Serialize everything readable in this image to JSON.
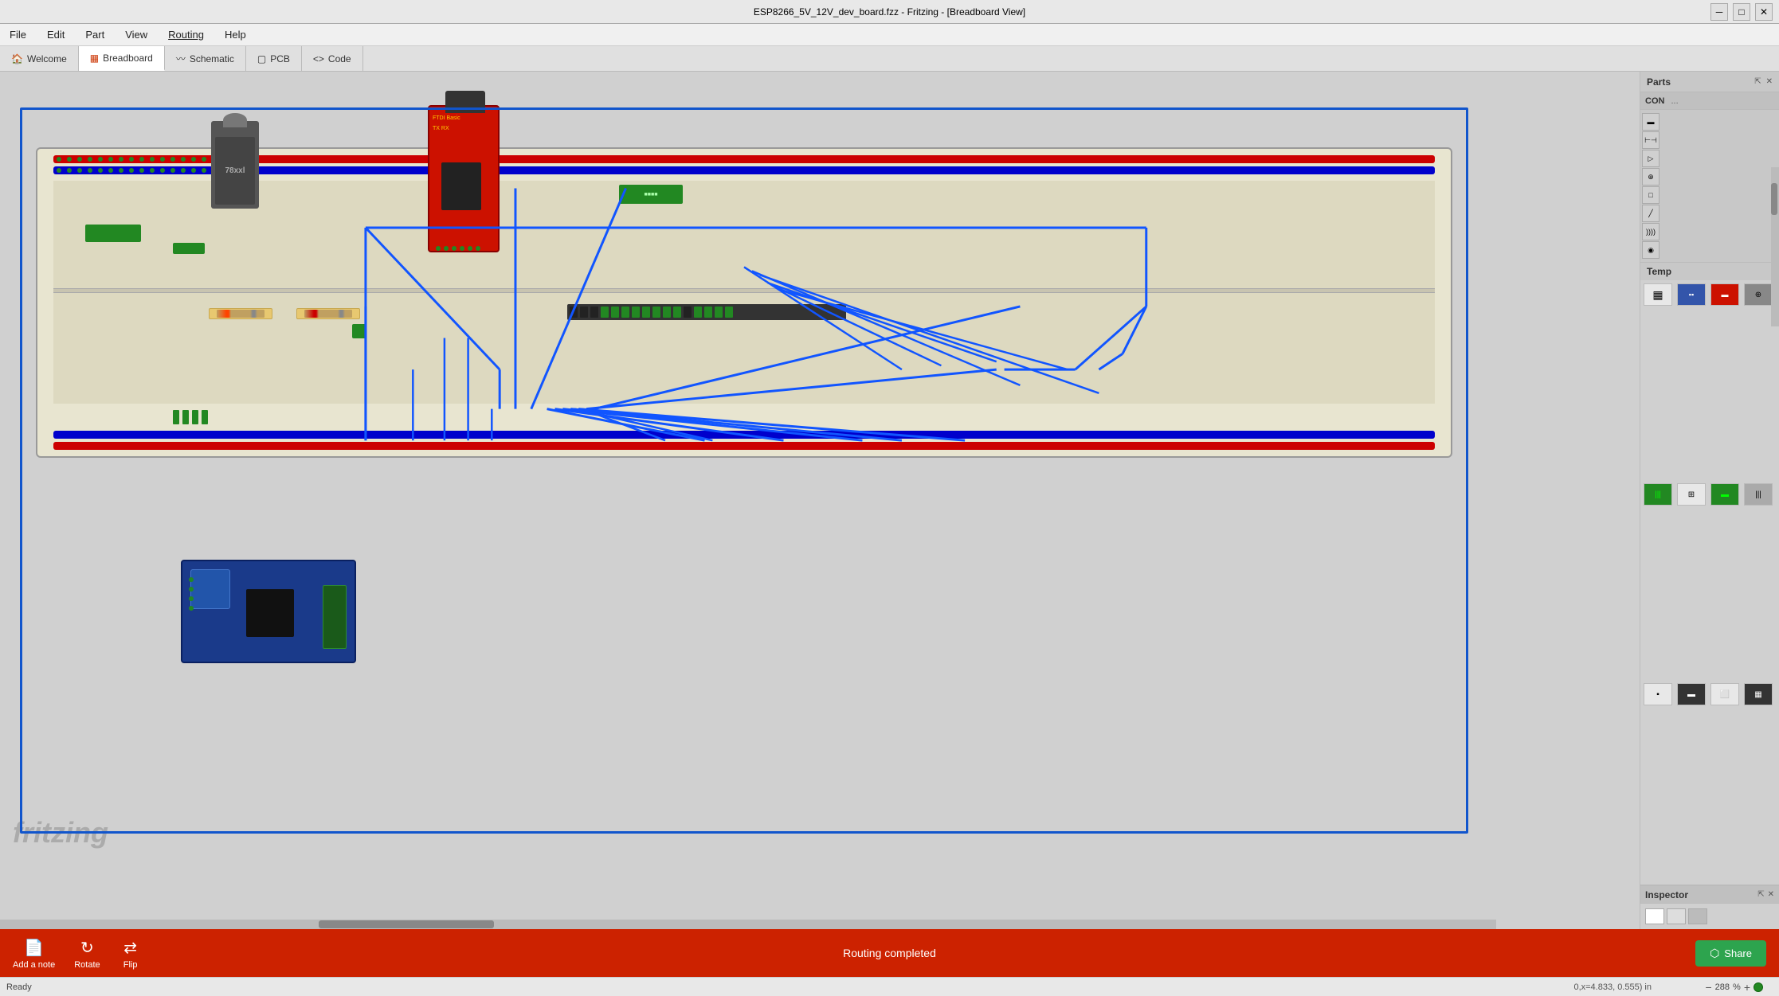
{
  "window": {
    "title": "ESP8266_5V_12V_dev_board.fzz - Fritzing - [Breadboard View]",
    "min_btn": "─",
    "max_btn": "□",
    "close_btn": "✕"
  },
  "menu": {
    "items": [
      "File",
      "Edit",
      "Part",
      "View",
      "Routing",
      "Help"
    ]
  },
  "tabs": [
    {
      "label": "Welcome",
      "icon": "🏠",
      "active": false
    },
    {
      "label": "Breadboard",
      "icon": "▦",
      "active": true
    },
    {
      "label": "Schematic",
      "icon": "~",
      "active": false
    },
    {
      "label": "PCB",
      "icon": "▢",
      "active": false
    },
    {
      "label": "Code",
      "icon": "<>",
      "active": false
    }
  ],
  "parts_panel": {
    "title": "Parts",
    "close_btn": "✕",
    "sub_tabs": [
      "CON",
      "..."
    ],
    "section_label": "Temp",
    "icons": [
      "▦",
      "▪▪",
      "▬",
      "⊕⊕",
      "▤",
      "⊕",
      "▬",
      "|||",
      "▪",
      "▬",
      "⬜",
      "▦"
    ]
  },
  "inspector": {
    "title": "Inspector",
    "close_btn": "✕",
    "swatches": [
      "#ffffff",
      "#dddddd",
      "#bbbbbb"
    ]
  },
  "toolbar": {
    "add_note_label": "Add a note",
    "rotate_label": "Rotate",
    "flip_label": "Flip",
    "share_label": "Share",
    "routing_status": "Routing completed"
  },
  "status_bar": {
    "status": "Ready",
    "coords": "0,x=4.833, 0.555) in",
    "zoom": "288",
    "zoom_unit": "%"
  },
  "breadboard": {
    "background": "#e8e4d0"
  },
  "fritzing": {
    "watermark": "fritzing"
  }
}
